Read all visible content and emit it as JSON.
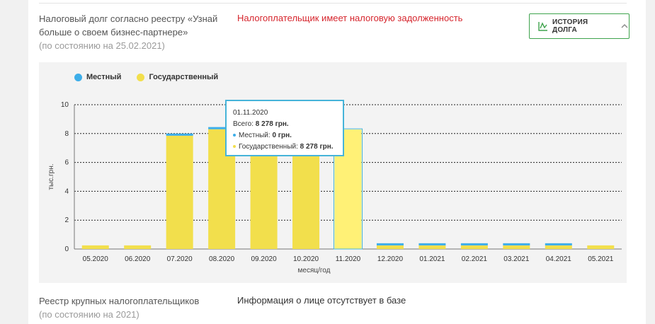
{
  "tax_debt": {
    "label": "Налоговый долг согласно реестру «Узнай больше о своем бизнес-партнере»",
    "as_of": "(по состоянию на 25.02.2021)",
    "status": "Налогоплательщик имеет налоговую задолженность",
    "history_button": "ИСТОРИЯ ДОЛГА"
  },
  "colors": {
    "local": "#3daee9",
    "state": "#f2df4c",
    "state_hover": "#fff176",
    "alert": "#d6252d",
    "accent": "#3fa34d"
  },
  "icons": {
    "history": "line-chart-icon",
    "collapse": "chevron-up-icon"
  },
  "chart_data": {
    "type": "bar",
    "stacked": true,
    "legend": [
      "Местный",
      "Государственный"
    ],
    "legend_position": "top-left",
    "ylabel": "тыс.грн.",
    "xlabel": "месяц/год",
    "ylim": [
      0,
      10
    ],
    "yticks": [
      0,
      2,
      4,
      6,
      8,
      10
    ],
    "grid": true,
    "categories": [
      "05.2020",
      "06.2020",
      "07.2020",
      "08.2020",
      "09.2020",
      "10.2020",
      "11.2020",
      "12.2020",
      "01.2021",
      "02.2021",
      "03.2021",
      "04.2021",
      "05.2021"
    ],
    "series": [
      {
        "name": "Местный",
        "values": [
          0,
          0,
          0.15,
          0.15,
          0.15,
          0.15,
          0,
          0.15,
          0.15,
          0.15,
          0.15,
          0.15,
          0
        ]
      },
      {
        "name": "Государственный",
        "values": [
          0.25,
          0.25,
          7.85,
          8.3,
          8.3,
          8.3,
          8.278,
          0.25,
          0.25,
          0.25,
          0.25,
          0.25,
          0.25
        ]
      }
    ],
    "tooltip": {
      "date": "01.11.2020",
      "total_label": "Всего:",
      "total_value": "8 278 грн.",
      "local_label": "Местный:",
      "local_value": "0 грн.",
      "state_label": "Государственный:",
      "state_value": "8 278 грн.",
      "active_index": 6
    }
  },
  "large_taxpayers": {
    "label": "Реестр крупных налогоплательщиков",
    "as_of": "(по состоянию на 2021)",
    "value": "Информация о лице отсутствует в базе"
  }
}
